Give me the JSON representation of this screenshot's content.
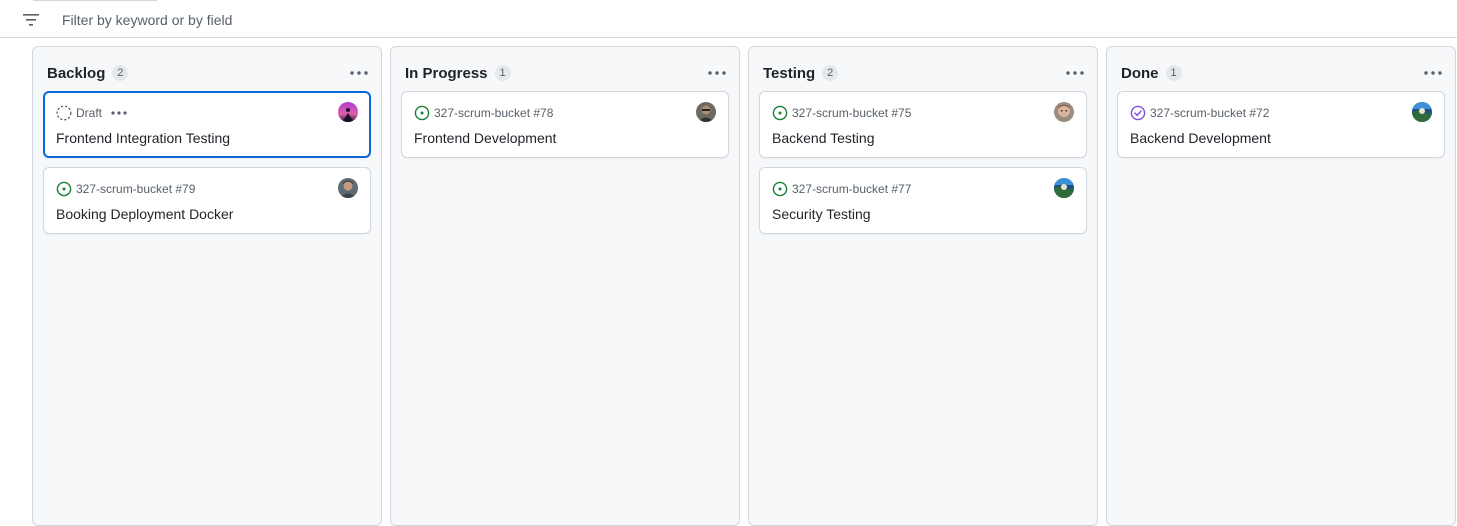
{
  "filter": {
    "placeholder": "Filter by keyword or by field",
    "icon": "filter-icon"
  },
  "columns": [
    {
      "name": "Backlog",
      "count": "2",
      "cards": [
        {
          "status": "draft",
          "ref": "Draft",
          "title": "Frontend Integration Testing",
          "selected": true
        },
        {
          "status": "open",
          "ref": "327-scrum-bucket #79",
          "title": "Booking Deployment Docker"
        }
      ]
    },
    {
      "name": "In Progress",
      "count": "1",
      "cards": [
        {
          "status": "open",
          "ref": "327-scrum-bucket #78",
          "title": "Frontend Development"
        }
      ]
    },
    {
      "name": "Testing",
      "count": "2",
      "cards": [
        {
          "status": "open",
          "ref": "327-scrum-bucket #75",
          "title": "Backend Testing"
        },
        {
          "status": "open",
          "ref": "327-scrum-bucket #77",
          "title": "Security Testing"
        }
      ]
    },
    {
      "name": "Done",
      "count": "1",
      "cards": [
        {
          "status": "closed",
          "ref": "327-scrum-bucket #72",
          "title": "Backend Development"
        }
      ]
    }
  ],
  "colors": {
    "open_status": "#1a7f37",
    "closed_status": "#8250df",
    "draft_status": "#57606a",
    "selected_border": "#0969da"
  }
}
